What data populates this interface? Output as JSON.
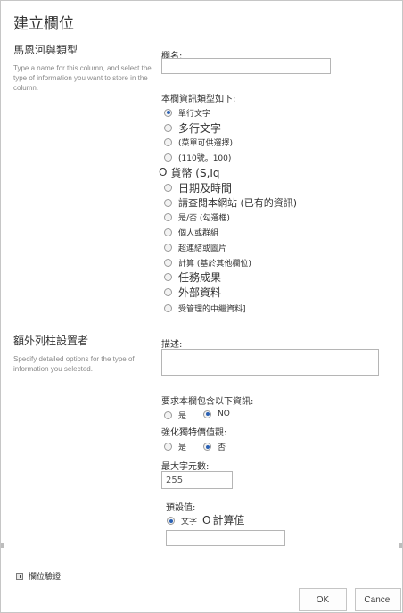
{
  "dialog": {
    "title": "建立欄位"
  },
  "name_section": {
    "title": "馬恩河與類型",
    "description": "Type a name for this column, and select the type of information you want to store in the column.",
    "column_name_label": "欄名:",
    "column_name_value": "",
    "type_label": "本欄資訊類型如下:",
    "types": [
      {
        "label": "單行文字",
        "selected": true
      },
      {
        "label": "多行文字",
        "selected": false
      },
      {
        "label": "(菜單可供選擇)",
        "selected": false
      },
      {
        "label": "(110號。100)",
        "selected": false
      },
      {
        "label": "貨幣 (S,Iq",
        "selected": false
      },
      {
        "label": "日期及時間",
        "selected": false
      },
      {
        "label": "請查閱本網站 (已有的資訊)",
        "selected": false
      },
      {
        "label": "是/否 (勾選框)",
        "selected": false
      },
      {
        "label": "個人或群組",
        "selected": false
      },
      {
        "label": "超連結或圖片",
        "selected": false
      },
      {
        "label": "計算 (基於其他欄位)",
        "selected": false
      },
      {
        "label": "任務成果",
        "selected": false
      },
      {
        "label": "外部資料",
        "selected": false
      },
      {
        "label": "受管理的中繼資料]",
        "selected": false
      }
    ]
  },
  "settings_section": {
    "title": "額外列柱設置者",
    "description": "Specify detailed options for the type of information you selected.",
    "description_label": "描述:",
    "require_label": "要求本欄包含以下資訊:",
    "require_yes": "是",
    "require_no": "NO",
    "unique_label": "強化獨特價值觀:",
    "unique_yes": "是",
    "unique_no": "否",
    "max_chars_label": "最大字元數:",
    "max_chars_value": "255",
    "default_label": "預設值:",
    "default_text_option": "文字",
    "default_calc_option": "計算值",
    "default_value": ""
  },
  "footer": {
    "validation_label": "欄位驗證",
    "ok_label": "OK",
    "cancel_label": "Cancel"
  }
}
